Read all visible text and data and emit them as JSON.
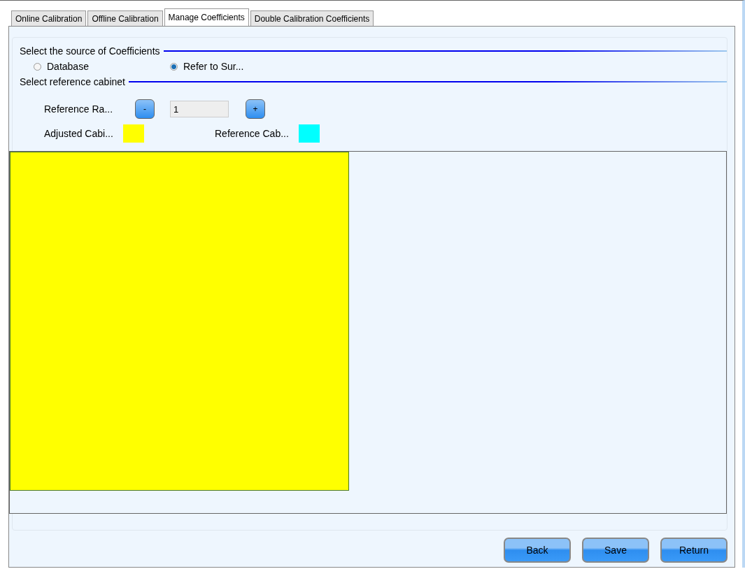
{
  "tabs": [
    {
      "label": "Online Calibration",
      "selected": false
    },
    {
      "label": "Offline Calibration",
      "selected": false
    },
    {
      "label": "Manage Coefficients",
      "selected": true
    },
    {
      "label": "Double Calibration Coefficients",
      "selected": false
    }
  ],
  "source_section": {
    "title": "Select the source of Coefficients",
    "options": [
      {
        "label": "Database",
        "selected": false
      },
      {
        "label": "Refer to Sur...",
        "selected": true
      }
    ]
  },
  "reference_section": {
    "title": "Select reference cabinet",
    "reference_label": "Reference Ra...",
    "decrement": "-",
    "value": "1",
    "increment": "+",
    "legend": [
      {
        "label": "Adjusted Cabi...",
        "color": "#ffff00"
      },
      {
        "label": "Reference Cab...",
        "color": "#00ffff"
      }
    ]
  },
  "canvas": {
    "cabinets": [
      {
        "color": "#ffff00"
      }
    ]
  },
  "buttons": [
    "Back",
    "Save",
    "Return"
  ]
}
